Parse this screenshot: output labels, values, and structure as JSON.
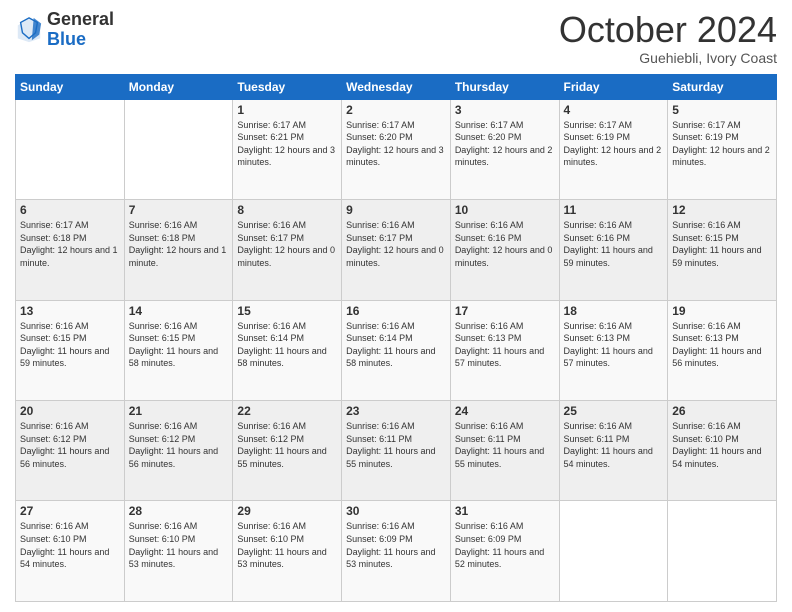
{
  "header": {
    "logo_general": "General",
    "logo_blue": "Blue",
    "month_title": "October 2024",
    "subtitle": "Guehiebli, Ivory Coast"
  },
  "weekdays": [
    "Sunday",
    "Monday",
    "Tuesday",
    "Wednesday",
    "Thursday",
    "Friday",
    "Saturday"
  ],
  "weeks": [
    [
      {
        "day": "",
        "info": ""
      },
      {
        "day": "",
        "info": ""
      },
      {
        "day": "1",
        "info": "Sunrise: 6:17 AM\nSunset: 6:21 PM\nDaylight: 12 hours and 3 minutes."
      },
      {
        "day": "2",
        "info": "Sunrise: 6:17 AM\nSunset: 6:20 PM\nDaylight: 12 hours and 3 minutes."
      },
      {
        "day": "3",
        "info": "Sunrise: 6:17 AM\nSunset: 6:20 PM\nDaylight: 12 hours and 2 minutes."
      },
      {
        "day": "4",
        "info": "Sunrise: 6:17 AM\nSunset: 6:19 PM\nDaylight: 12 hours and 2 minutes."
      },
      {
        "day": "5",
        "info": "Sunrise: 6:17 AM\nSunset: 6:19 PM\nDaylight: 12 hours and 2 minutes."
      }
    ],
    [
      {
        "day": "6",
        "info": "Sunrise: 6:17 AM\nSunset: 6:18 PM\nDaylight: 12 hours and 1 minute."
      },
      {
        "day": "7",
        "info": "Sunrise: 6:16 AM\nSunset: 6:18 PM\nDaylight: 12 hours and 1 minute."
      },
      {
        "day": "8",
        "info": "Sunrise: 6:16 AM\nSunset: 6:17 PM\nDaylight: 12 hours and 0 minutes."
      },
      {
        "day": "9",
        "info": "Sunrise: 6:16 AM\nSunset: 6:17 PM\nDaylight: 12 hours and 0 minutes."
      },
      {
        "day": "10",
        "info": "Sunrise: 6:16 AM\nSunset: 6:16 PM\nDaylight: 12 hours and 0 minutes."
      },
      {
        "day": "11",
        "info": "Sunrise: 6:16 AM\nSunset: 6:16 PM\nDaylight: 11 hours and 59 minutes."
      },
      {
        "day": "12",
        "info": "Sunrise: 6:16 AM\nSunset: 6:15 PM\nDaylight: 11 hours and 59 minutes."
      }
    ],
    [
      {
        "day": "13",
        "info": "Sunrise: 6:16 AM\nSunset: 6:15 PM\nDaylight: 11 hours and 59 minutes."
      },
      {
        "day": "14",
        "info": "Sunrise: 6:16 AM\nSunset: 6:15 PM\nDaylight: 11 hours and 58 minutes."
      },
      {
        "day": "15",
        "info": "Sunrise: 6:16 AM\nSunset: 6:14 PM\nDaylight: 11 hours and 58 minutes."
      },
      {
        "day": "16",
        "info": "Sunrise: 6:16 AM\nSunset: 6:14 PM\nDaylight: 11 hours and 58 minutes."
      },
      {
        "day": "17",
        "info": "Sunrise: 6:16 AM\nSunset: 6:13 PM\nDaylight: 11 hours and 57 minutes."
      },
      {
        "day": "18",
        "info": "Sunrise: 6:16 AM\nSunset: 6:13 PM\nDaylight: 11 hours and 57 minutes."
      },
      {
        "day": "19",
        "info": "Sunrise: 6:16 AM\nSunset: 6:13 PM\nDaylight: 11 hours and 56 minutes."
      }
    ],
    [
      {
        "day": "20",
        "info": "Sunrise: 6:16 AM\nSunset: 6:12 PM\nDaylight: 11 hours and 56 minutes."
      },
      {
        "day": "21",
        "info": "Sunrise: 6:16 AM\nSunset: 6:12 PM\nDaylight: 11 hours and 56 minutes."
      },
      {
        "day": "22",
        "info": "Sunrise: 6:16 AM\nSunset: 6:12 PM\nDaylight: 11 hours and 55 minutes."
      },
      {
        "day": "23",
        "info": "Sunrise: 6:16 AM\nSunset: 6:11 PM\nDaylight: 11 hours and 55 minutes."
      },
      {
        "day": "24",
        "info": "Sunrise: 6:16 AM\nSunset: 6:11 PM\nDaylight: 11 hours and 55 minutes."
      },
      {
        "day": "25",
        "info": "Sunrise: 6:16 AM\nSunset: 6:11 PM\nDaylight: 11 hours and 54 minutes."
      },
      {
        "day": "26",
        "info": "Sunrise: 6:16 AM\nSunset: 6:10 PM\nDaylight: 11 hours and 54 minutes."
      }
    ],
    [
      {
        "day": "27",
        "info": "Sunrise: 6:16 AM\nSunset: 6:10 PM\nDaylight: 11 hours and 54 minutes."
      },
      {
        "day": "28",
        "info": "Sunrise: 6:16 AM\nSunset: 6:10 PM\nDaylight: 11 hours and 53 minutes."
      },
      {
        "day": "29",
        "info": "Sunrise: 6:16 AM\nSunset: 6:10 PM\nDaylight: 11 hours and 53 minutes."
      },
      {
        "day": "30",
        "info": "Sunrise: 6:16 AM\nSunset: 6:09 PM\nDaylight: 11 hours and 53 minutes."
      },
      {
        "day": "31",
        "info": "Sunrise: 6:16 AM\nSunset: 6:09 PM\nDaylight: 11 hours and 52 minutes."
      },
      {
        "day": "",
        "info": ""
      },
      {
        "day": "",
        "info": ""
      }
    ]
  ]
}
